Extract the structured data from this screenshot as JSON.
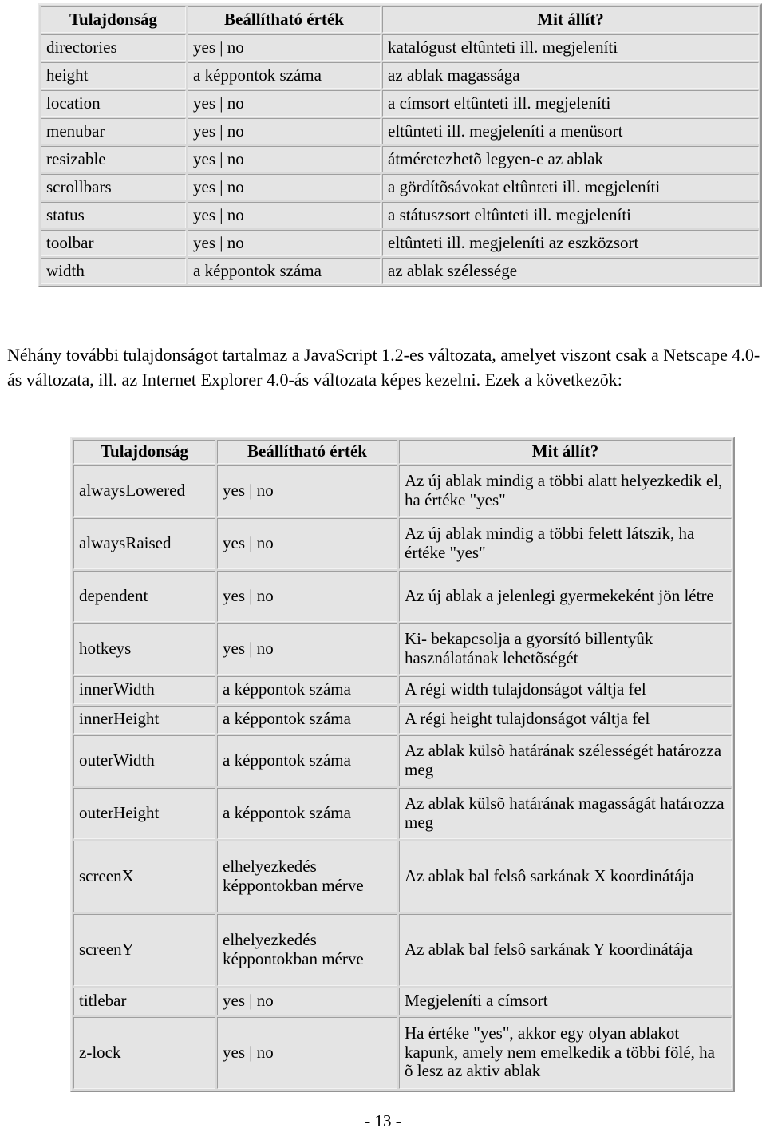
{
  "page": {
    "footer": "- 13 -",
    "background": "#ffffff",
    "cell_background": "#e4e4e4",
    "table_background": "#d9d9d9"
  },
  "table_one": {
    "headers": [
      "Tulajdonság",
      "Beállítható érték",
      "Mit állít?"
    ],
    "rows": [
      [
        "directories",
        "yes | no",
        "katalógust eltûnteti ill. megjeleníti"
      ],
      [
        "height",
        "a képpontok száma",
        "az ablak magassága"
      ],
      [
        "location",
        "yes | no",
        "a címsort eltûnteti ill. megjeleníti"
      ],
      [
        "menubar",
        "yes | no",
        "eltûnteti ill. megjeleníti a menüsort"
      ],
      [
        "resizable",
        "yes | no",
        "átméretezhetõ legyen-e az ablak"
      ],
      [
        "scrollbars",
        "yes | no",
        "a gördítõsávokat eltûnteti ill. megjeleníti"
      ],
      [
        "status",
        "yes | no",
        "a státuszsort eltûnteti ill. megjeleníti"
      ],
      [
        "toolbar",
        "yes | no",
        "eltûnteti ill. megjeleníti az eszközsort"
      ],
      [
        "width",
        "a képpontok száma",
        "az ablak szélessége"
      ]
    ]
  },
  "paragraph": "Néhány további tulajdonságot tartalmaz a JavaScript 1.2-es változata, amelyet viszont csak a Netscape 4.0-ás változata, ill. az Internet Explorer 4.0-ás változata képes kezelni. Ezek a következõk:",
  "table_two": {
    "headers": [
      "Tulajdonság",
      "Beállítható érték",
      "Mit állít?"
    ],
    "rows": [
      [
        "alwaysLowered",
        "yes | no",
        "Az új ablak mindig a többi alatt helyezkedik el, ha értéke \"yes\""
      ],
      [
        "alwaysRaised",
        "yes | no",
        "Az új ablak mindig a többi felett látszik, ha értéke \"yes\""
      ],
      [
        "dependent",
        "yes | no",
        "Az új ablak a jelenlegi gyermekeként jön létre"
      ],
      [
        "hotkeys",
        "yes | no",
        "Ki- bekapcsolja a gyorsító billentyûk használatának lehetõségét"
      ],
      [
        "innerWidth",
        "a képpontok száma",
        "A régi width tulajdonságot váltja fel"
      ],
      [
        "innerHeight",
        "a képpontok száma",
        "A régi height tulajdonságot váltja fel"
      ],
      [
        "outerWidth",
        "a képpontok száma",
        "Az ablak külsõ határának szélességét határozza meg"
      ],
      [
        "outerHeight",
        "a képpontok száma",
        "Az ablak külsõ határának magasságát határozza meg"
      ],
      [
        "screenX",
        "elhelyezkedés képpontokban mérve",
        "Az ablak bal felsô sarkának X koordinátája"
      ],
      [
        "screenY",
        "elhelyezkedés képpontokban mérve",
        "Az ablak bal felsô sarkának Y koordinátája"
      ],
      [
        "titlebar",
        "yes | no",
        "Megjeleníti a címsort"
      ],
      [
        "z-lock",
        "yes | no",
        "Ha értéke \"yes\", akkor egy olyan ablakot kapunk, amely nem emelkedik a többi fölé, ha õ lesz az aktiv ablak"
      ]
    ]
  }
}
